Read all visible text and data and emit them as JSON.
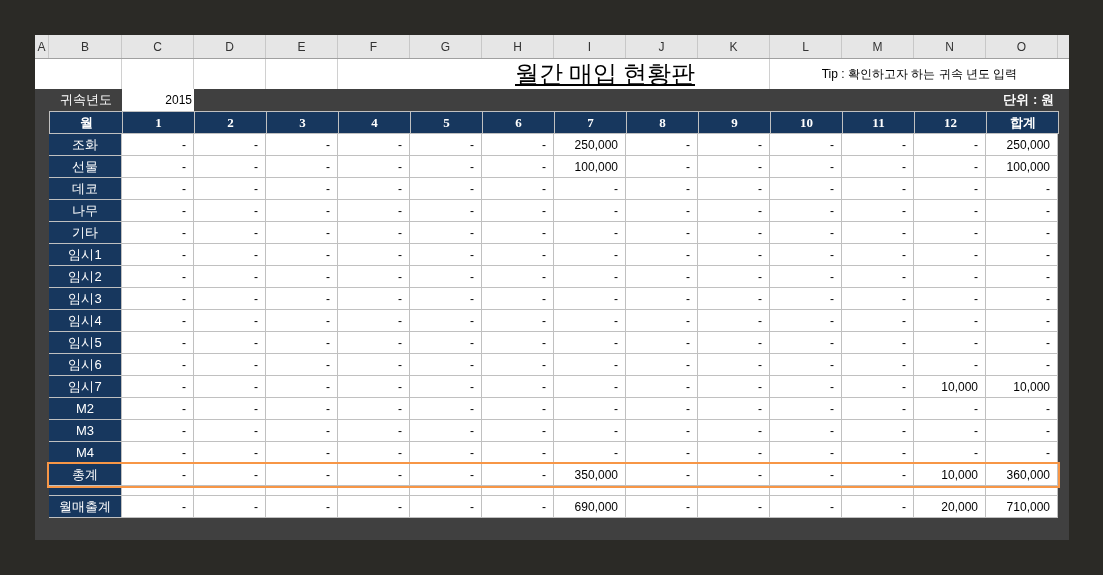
{
  "columns": [
    "A",
    "B",
    "C",
    "D",
    "E",
    "F",
    "G",
    "H",
    "I",
    "J",
    "K",
    "L",
    "M",
    "N",
    "O"
  ],
  "title": "월간 매입 현황판",
  "tip": "Tip : 확인하고자 하는 귀속 년도 입력",
  "year_label": "귀속년도",
  "year_value": "2015",
  "unit": "단위 : 원",
  "table_header": [
    "월",
    "1",
    "2",
    "3",
    "4",
    "5",
    "6",
    "7",
    "8",
    "9",
    "10",
    "11",
    "12",
    "합계"
  ],
  "rows": [
    {
      "kind": "item",
      "label": "조화",
      "highlighted": false,
      "values": [
        "-",
        "-",
        "-",
        "-",
        "-",
        "-",
        "250,000",
        "-",
        "-",
        "-",
        "-",
        "-",
        "250,000"
      ]
    },
    {
      "kind": "item",
      "label": "선물",
      "highlighted": false,
      "values": [
        "-",
        "-",
        "-",
        "-",
        "-",
        "-",
        "100,000",
        "-",
        "-",
        "-",
        "-",
        "-",
        "100,000"
      ]
    },
    {
      "kind": "item",
      "label": "데코",
      "highlighted": false,
      "values": [
        "-",
        "-",
        "-",
        "-",
        "-",
        "-",
        "-",
        "-",
        "-",
        "-",
        "-",
        "-",
        "-"
      ]
    },
    {
      "kind": "item",
      "label": "나무",
      "highlighted": false,
      "values": [
        "-",
        "-",
        "-",
        "-",
        "-",
        "-",
        "-",
        "-",
        "-",
        "-",
        "-",
        "-",
        "-"
      ]
    },
    {
      "kind": "item",
      "label": "기타",
      "highlighted": false,
      "values": [
        "-",
        "-",
        "-",
        "-",
        "-",
        "-",
        "-",
        "-",
        "-",
        "-",
        "-",
        "-",
        "-"
      ]
    },
    {
      "kind": "item",
      "label": "임시1",
      "highlighted": false,
      "values": [
        "-",
        "-",
        "-",
        "-",
        "-",
        "-",
        "-",
        "-",
        "-",
        "-",
        "-",
        "-",
        "-"
      ]
    },
    {
      "kind": "item",
      "label": "임시2",
      "highlighted": false,
      "values": [
        "-",
        "-",
        "-",
        "-",
        "-",
        "-",
        "-",
        "-",
        "-",
        "-",
        "-",
        "-",
        "-"
      ]
    },
    {
      "kind": "item",
      "label": "임시3",
      "highlighted": false,
      "values": [
        "-",
        "-",
        "-",
        "-",
        "-",
        "-",
        "-",
        "-",
        "-",
        "-",
        "-",
        "-",
        "-"
      ]
    },
    {
      "kind": "item",
      "label": "임시4",
      "highlighted": false,
      "values": [
        "-",
        "-",
        "-",
        "-",
        "-",
        "-",
        "-",
        "-",
        "-",
        "-",
        "-",
        "-",
        "-"
      ]
    },
    {
      "kind": "item",
      "label": "임시5",
      "highlighted": false,
      "values": [
        "-",
        "-",
        "-",
        "-",
        "-",
        "-",
        "-",
        "-",
        "-",
        "-",
        "-",
        "-",
        "-"
      ]
    },
    {
      "kind": "item",
      "label": "임시6",
      "highlighted": false,
      "values": [
        "-",
        "-",
        "-",
        "-",
        "-",
        "-",
        "-",
        "-",
        "-",
        "-",
        "-",
        "-",
        "-"
      ]
    },
    {
      "kind": "item",
      "label": "임시7",
      "highlighted": false,
      "values": [
        "-",
        "-",
        "-",
        "-",
        "-",
        "-",
        "-",
        "-",
        "-",
        "-",
        "-",
        "10,000",
        "10,000"
      ]
    },
    {
      "kind": "item",
      "label": "M2",
      "highlighted": false,
      "values": [
        "-",
        "-",
        "-",
        "-",
        "-",
        "-",
        "-",
        "-",
        "-",
        "-",
        "-",
        "-",
        "-"
      ]
    },
    {
      "kind": "item",
      "label": "M3",
      "highlighted": false,
      "values": [
        "-",
        "-",
        "-",
        "-",
        "-",
        "-",
        "-",
        "-",
        "-",
        "-",
        "-",
        "-",
        "-"
      ]
    },
    {
      "kind": "item",
      "label": "M4",
      "highlighted": false,
      "values": [
        "-",
        "-",
        "-",
        "-",
        "-",
        "-",
        "-",
        "-",
        "-",
        "-",
        "-",
        "-",
        "-"
      ]
    },
    {
      "kind": "item",
      "label": "총계",
      "highlighted": true,
      "values": [
        "-",
        "-",
        "-",
        "-",
        "-",
        "-",
        "350,000",
        "-",
        "-",
        "-",
        "-",
        "10,000",
        "360,000"
      ]
    },
    {
      "kind": "spacer",
      "highlighted": false
    },
    {
      "kind": "item",
      "label": "월매출계",
      "highlighted": false,
      "values": [
        "-",
        "-",
        "-",
        "-",
        "-",
        "-",
        "690,000",
        "-",
        "-",
        "-",
        "-",
        "20,000",
        "710,000"
      ]
    }
  ]
}
